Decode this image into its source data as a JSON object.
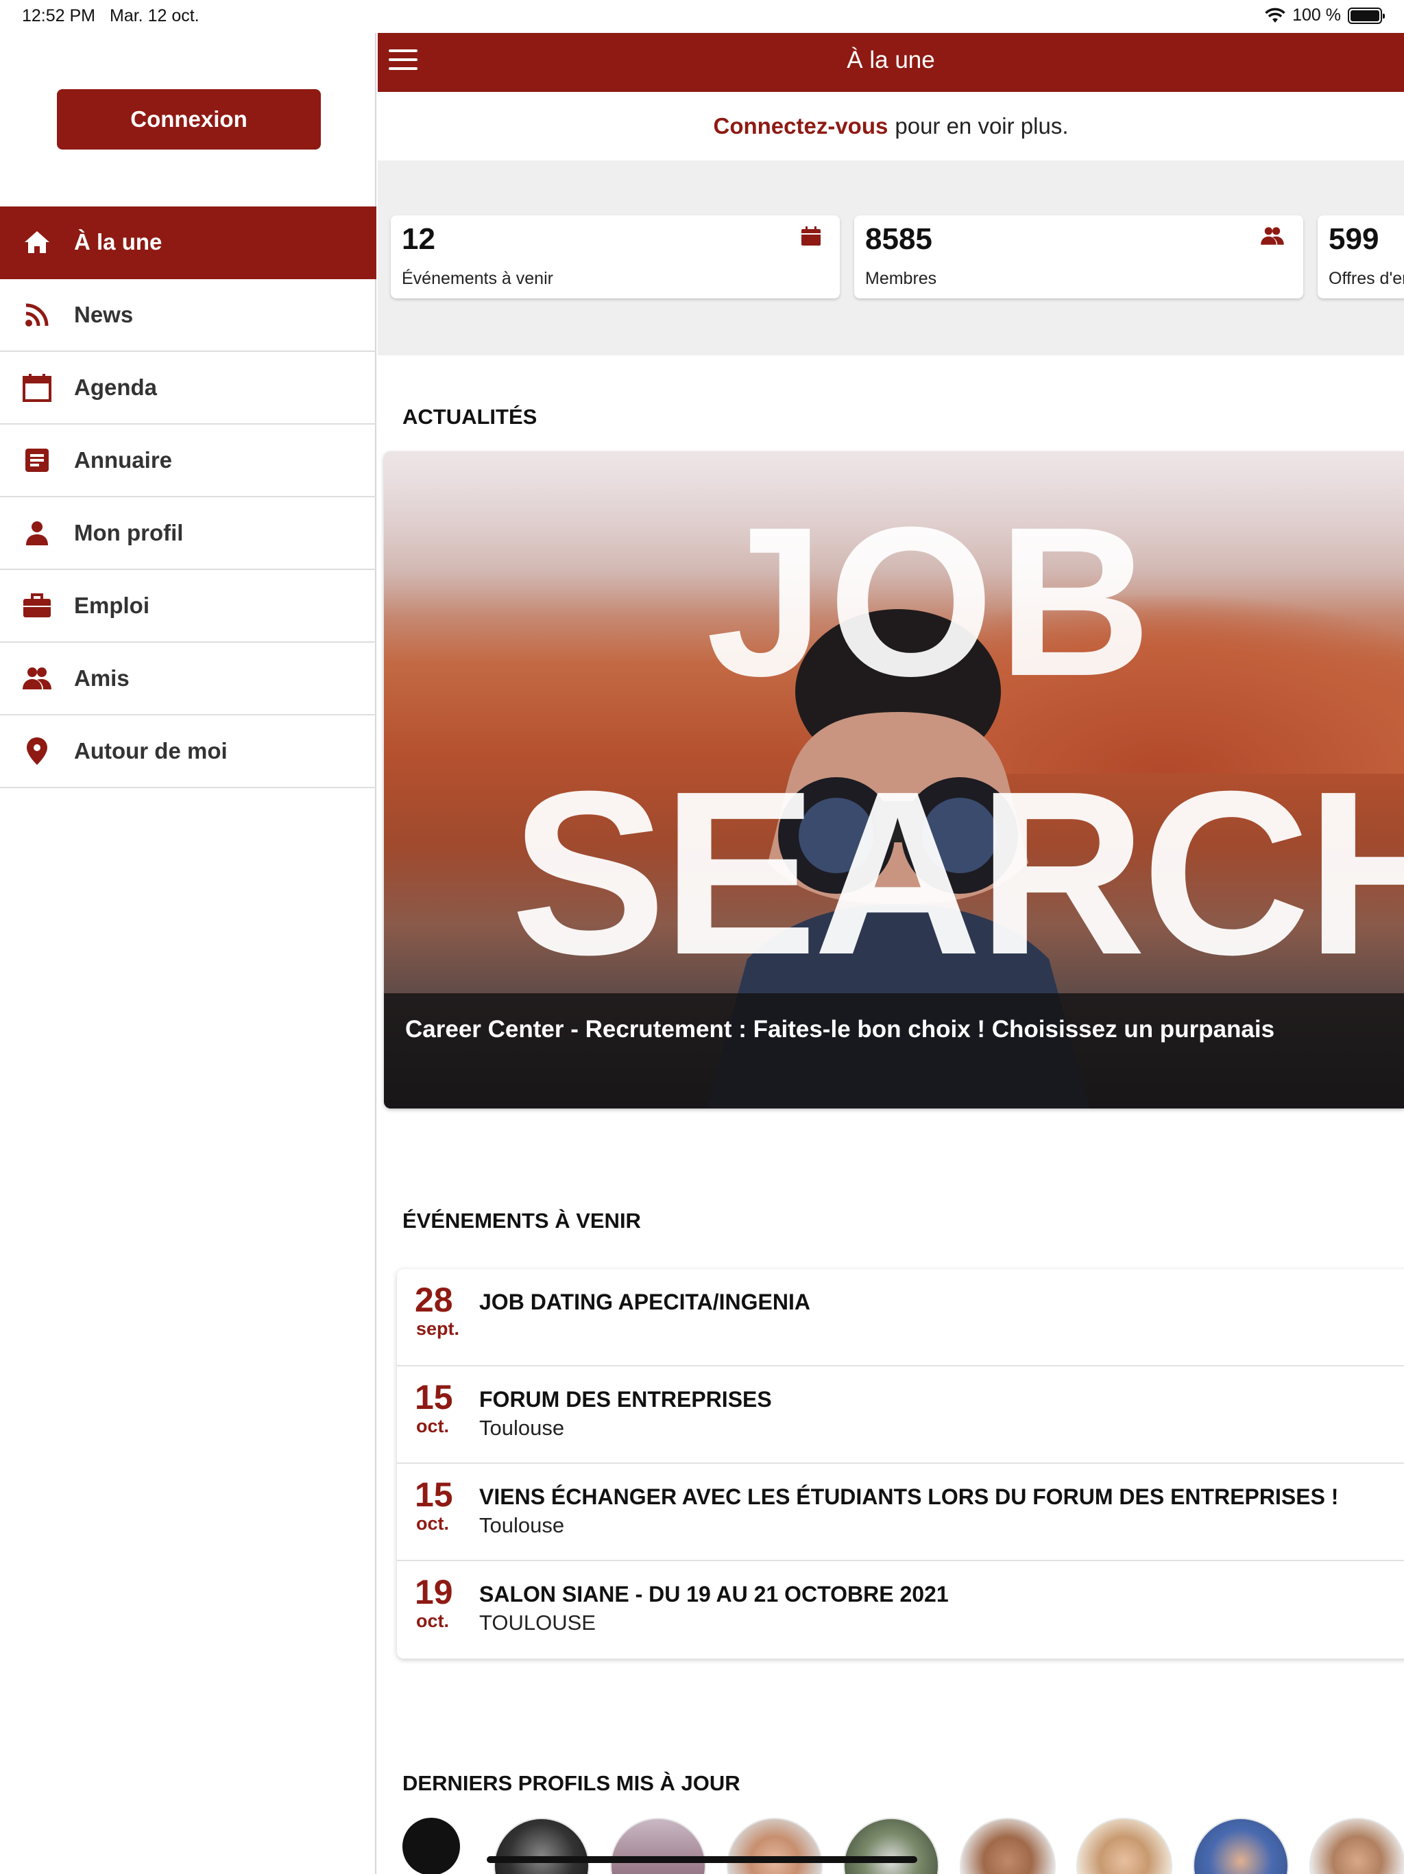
{
  "status_bar": {
    "time": "12:52 PM",
    "date": "Mar. 12 oct.",
    "battery": "100 %"
  },
  "sidebar": {
    "login_label": "Connexion",
    "items": [
      {
        "label": "À la une",
        "icon": "home-icon",
        "active": true
      },
      {
        "label": "News",
        "icon": "rss-icon",
        "active": false
      },
      {
        "label": "Agenda",
        "icon": "calendar-icon",
        "active": false
      },
      {
        "label": "Annuaire",
        "icon": "directory-icon",
        "active": false
      },
      {
        "label": "Mon profil",
        "icon": "person-icon",
        "active": false
      },
      {
        "label": "Emploi",
        "icon": "briefcase-icon",
        "active": false
      },
      {
        "label": "Amis",
        "icon": "friends-icon",
        "active": false
      },
      {
        "label": "Autour de moi",
        "icon": "location-pin-icon",
        "active": false
      }
    ]
  },
  "header": {
    "title": "À la une"
  },
  "connect_banner": {
    "link": "Connectez-vous",
    "text": "pour en voir plus."
  },
  "stats": [
    {
      "value": "12",
      "label": "Événements à venir",
      "icon": "calendar-icon"
    },
    {
      "value": "8585",
      "label": "Membres",
      "icon": "friends-icon"
    },
    {
      "value": "599",
      "label": "Offres d'emploi",
      "icon": "briefcase-icon"
    }
  ],
  "news": {
    "section_title": "ACTUALITÉS",
    "image_words": [
      "JOB",
      "SEARCH"
    ],
    "caption": "Career Center - Recrutement : Faites-le bon choix ! Choisissez un purpanais"
  },
  "events": {
    "section_title": "ÉVÉNEMENTS À VENIR",
    "items": [
      {
        "day": "28",
        "month": "sept.",
        "name": "JOB DATING APECITA/INGENIA",
        "place": ""
      },
      {
        "day": "15",
        "month": "oct.",
        "name": "FORUM DES ENTREPRISES",
        "place": "Toulouse"
      },
      {
        "day": "15",
        "month": "oct.",
        "name": "VIENS ÉCHANGER AVEC LES ÉTUDIANTS LORS DU FORUM DES ENTREPRISES !",
        "place": "Toulouse"
      },
      {
        "day": "19",
        "month": "oct.",
        "name": "SALON SIANE - DU 19 AU 21 OCTOBRE 2021",
        "place": "TOULOUSE"
      }
    ]
  },
  "profiles": {
    "section_title": "DERNIERS PROFILS MIS À JOUR"
  },
  "colors": {
    "brand": "#8e1a13",
    "background": "#efefef"
  }
}
